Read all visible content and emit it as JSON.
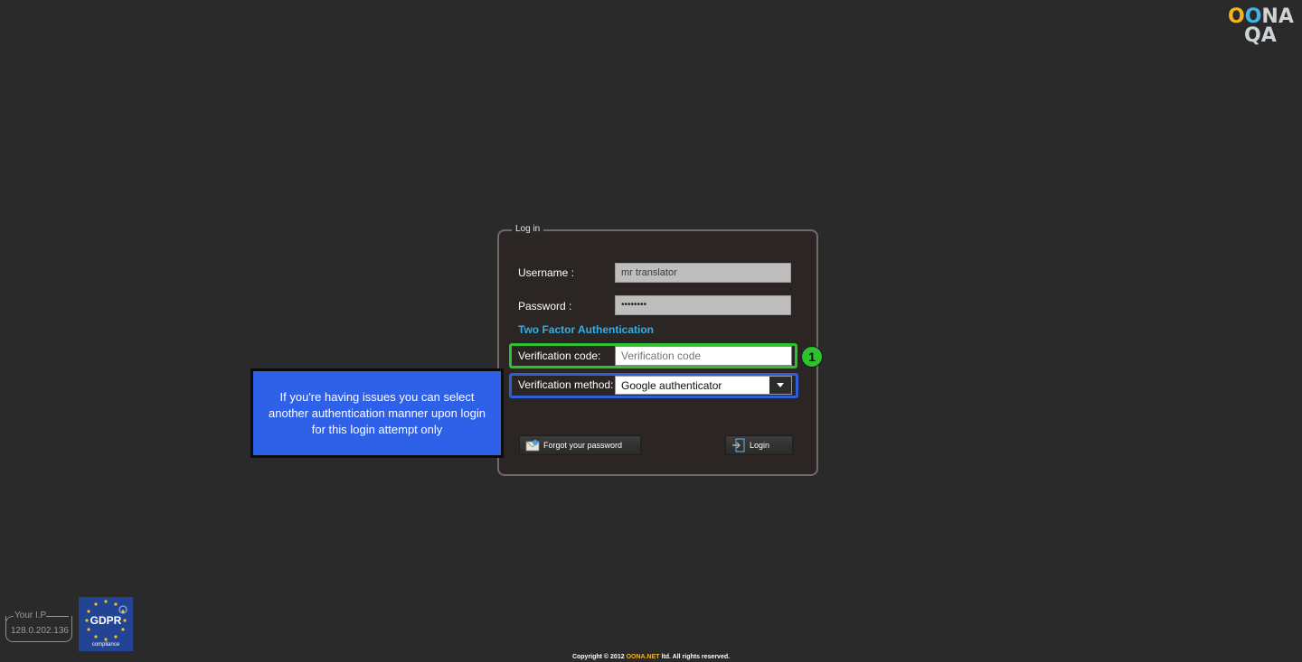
{
  "logo": {
    "row1": [
      "O",
      "O",
      "NA"
    ],
    "row2": "QA"
  },
  "login": {
    "legend": "Log in",
    "username_label": "Username :",
    "username_value": "mr translator",
    "password_label": "Password :",
    "password_value": "••••••••",
    "tfa_title": "Two Factor Authentication",
    "verification_code_label": "Verification code:",
    "verification_code_placeholder": "Verification code",
    "verification_method_label": "Verification method:",
    "verification_method_value": "Google authenticator",
    "forgot_label": "Forgot your password",
    "login_label": "Login"
  },
  "annotation": {
    "badge": "1",
    "tooltip": "If you're having issues you can select another authentication manner upon login for this login attempt only"
  },
  "footer": {
    "ip_label": "Your I.P",
    "ip_value": "128.0.202.136",
    "gdpr_title": "GDPR",
    "gdpr_sub": "compliance",
    "copyright_prefix": "Copyright © 2012 ",
    "copyright_brand": "OONA.NET",
    "copyright_suffix": " ltd. All rights reserved."
  },
  "colors": {
    "accent": "#2fb0e8",
    "green": "#2fc22f",
    "blue": "#2f5ed6",
    "tooltip_bg": "#2e60e8",
    "brand_yellow": "#f2b51e"
  }
}
